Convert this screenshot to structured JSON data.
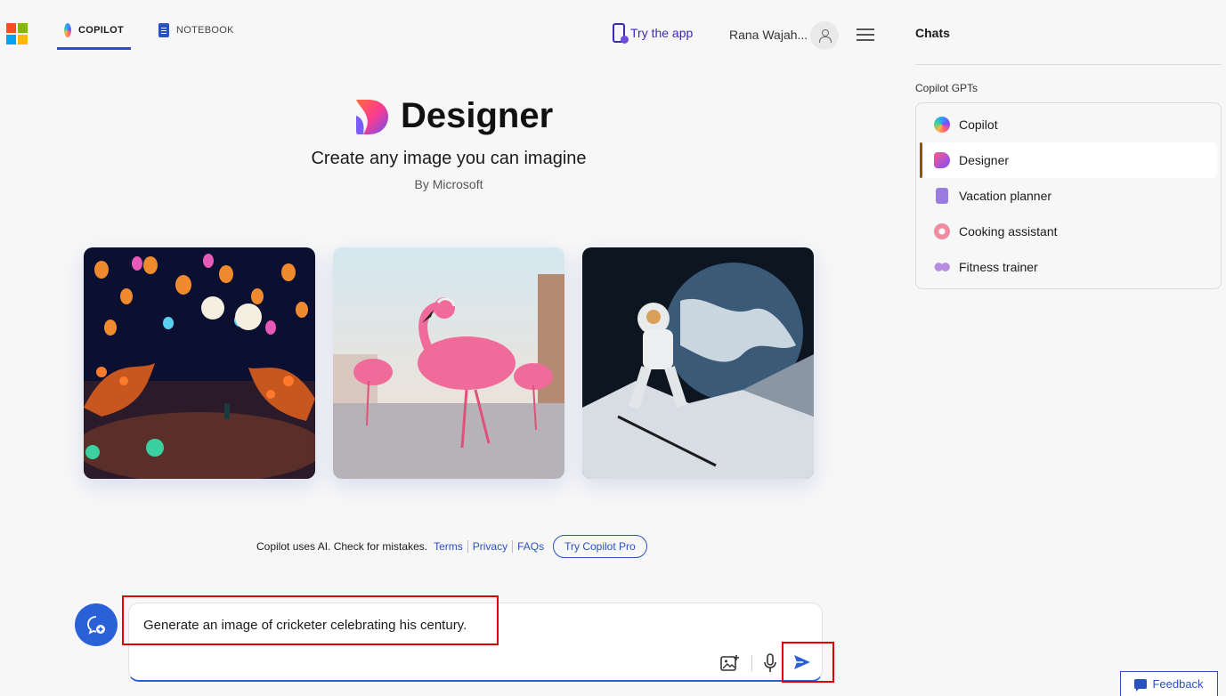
{
  "header": {
    "tabs": [
      {
        "label": "COPILOT",
        "active": true
      },
      {
        "label": "NOTEBOOK",
        "active": false
      }
    ],
    "try_app_label": "Try the app",
    "user_name": "Rana Wajah..."
  },
  "hero": {
    "title": "Designer",
    "subtitle": "Create any image you can imagine",
    "by": "By Microsoft"
  },
  "gallery": {
    "images": [
      "lantern-fantasy-scene",
      "flamingo-with-headphones",
      "astronaut-skiing-moon"
    ]
  },
  "footer": {
    "disclaimer": "Copilot uses AI. Check for mistakes.",
    "links": [
      "Terms",
      "Privacy",
      "FAQs"
    ],
    "pro_button": "Try Copilot Pro"
  },
  "compose": {
    "value": "Generate an image of cricketer celebrating his century."
  },
  "sidebar": {
    "title": "Chats",
    "section_label": "Copilot GPTs",
    "items": [
      {
        "label": "Copilot",
        "icon": "copilot-icon"
      },
      {
        "label": "Designer",
        "icon": "designer-icon",
        "active": true
      },
      {
        "label": "Vacation planner",
        "icon": "suitcase-icon"
      },
      {
        "label": "Cooking assistant",
        "icon": "donut-icon"
      },
      {
        "label": "Fitness trainer",
        "icon": "dumbbell-icon"
      }
    ]
  },
  "feedback_label": "Feedback",
  "colors": {
    "accent": "#2a52be",
    "highlight": "#e00000",
    "brand_purple": "#3a2bb0"
  }
}
